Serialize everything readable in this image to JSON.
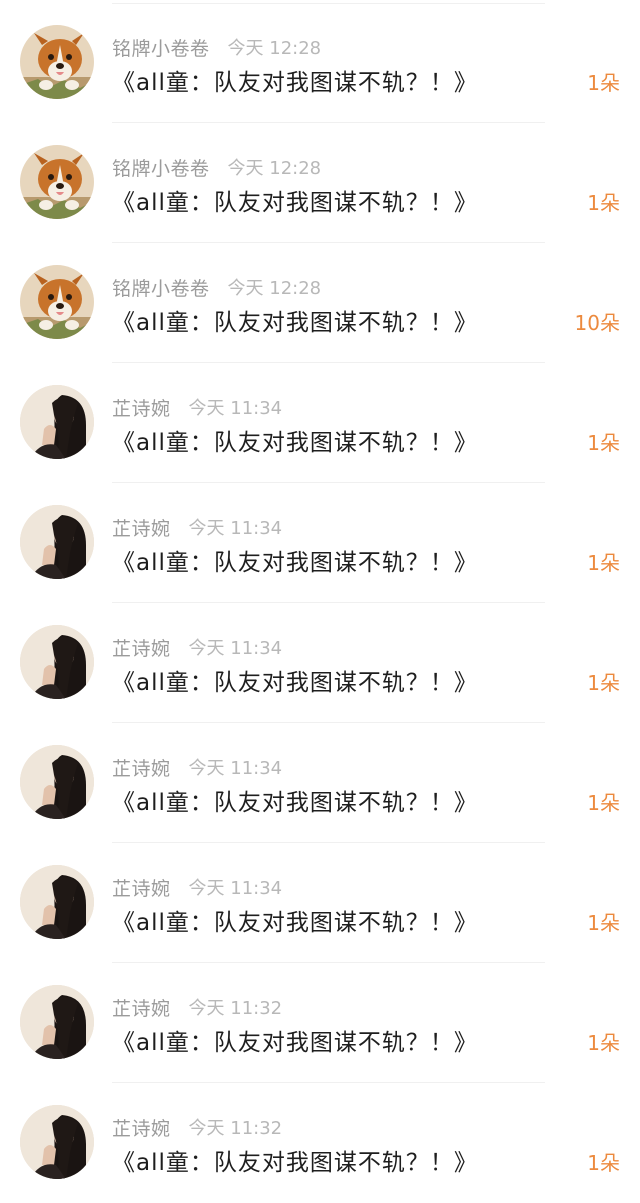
{
  "colors": {
    "count_accent": "#ec8a3e",
    "name_text": "#9b9b9b",
    "time_text": "#b8b8b8",
    "title_text": "#1e1e1e"
  },
  "items": [
    {
      "avatar": "dog-avatar",
      "name": "铭牌小卷卷",
      "time": "今天 12:28",
      "title": "《all童：队友对我图谋不轨？！》",
      "count": "1朵"
    },
    {
      "avatar": "dog-avatar",
      "name": "铭牌小卷卷",
      "time": "今天 12:28",
      "title": "《all童：队友对我图谋不轨？！》",
      "count": "1朵"
    },
    {
      "avatar": "dog-avatar",
      "name": "铭牌小卷卷",
      "time": "今天 12:28",
      "title": "《all童：队友对我图谋不轨？！》",
      "count": "10朵"
    },
    {
      "avatar": "girl-avatar",
      "name": "芷诗婉",
      "time": "今天 11:34",
      "title": "《all童：队友对我图谋不轨？！》",
      "count": "1朵"
    },
    {
      "avatar": "girl-avatar",
      "name": "芷诗婉",
      "time": "今天 11:34",
      "title": "《all童：队友对我图谋不轨？！》",
      "count": "1朵"
    },
    {
      "avatar": "girl-avatar",
      "name": "芷诗婉",
      "time": "今天 11:34",
      "title": "《all童：队友对我图谋不轨？！》",
      "count": "1朵"
    },
    {
      "avatar": "girl-avatar",
      "name": "芷诗婉",
      "time": "今天 11:34",
      "title": "《all童：队友对我图谋不轨？！》",
      "count": "1朵"
    },
    {
      "avatar": "girl-avatar",
      "name": "芷诗婉",
      "time": "今天 11:34",
      "title": "《all童：队友对我图谋不轨？！》",
      "count": "1朵"
    },
    {
      "avatar": "girl-avatar",
      "name": "芷诗婉",
      "time": "今天 11:32",
      "title": "《all童：队友对我图谋不轨？！》",
      "count": "1朵"
    },
    {
      "avatar": "girl-avatar",
      "name": "芷诗婉",
      "time": "今天 11:32",
      "title": "《all童：队友对我图谋不轨？！》",
      "count": "1朵"
    }
  ]
}
